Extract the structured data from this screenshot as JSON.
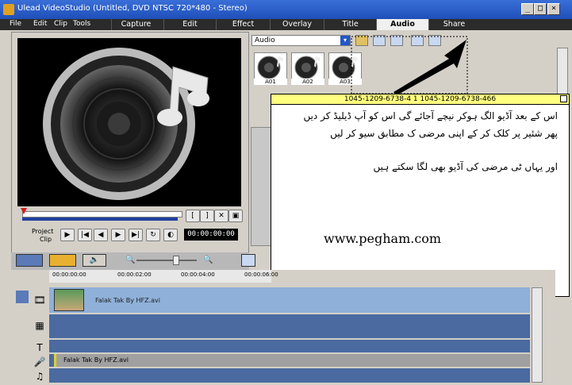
{
  "window": {
    "title": "Ulead VideoStudio (Untitled, DVD NTSC 720*480 - Stereo)"
  },
  "menu": {
    "items": [
      "File",
      "Edit",
      "Clip",
      "Tools"
    ]
  },
  "tabs": [
    {
      "label": "Capture"
    },
    {
      "label": "Edit"
    },
    {
      "label": "Effect"
    },
    {
      "label": "Overlay"
    },
    {
      "label": "Title"
    },
    {
      "label": "Audio",
      "active": true
    },
    {
      "label": "Share"
    }
  ],
  "library": {
    "category": "Audio",
    "thumbs": [
      {
        "label": "A01"
      },
      {
        "label": "A02"
      },
      {
        "label": "A03"
      }
    ]
  },
  "player": {
    "project_label": "Project",
    "clip_label": "Clip",
    "timecode": "00:00:00:00"
  },
  "timeline": {
    "ruler": [
      "00:00:00:00",
      "00:00:02:00",
      "00:00:04:00",
      "00:00:06:00"
    ],
    "video_clip": "Falak Tak By HFZ.avi",
    "audio_clip": "Falak Tak By HFZ.avi"
  },
  "note": {
    "header": "1045-1209-6738-4 1 1045-1209-6738-466",
    "line1": "اس کے بعد آڈیو الگ ہوکر نیچے آجائے گی اس کو آپ ڈیلیڈ کر دیں",
    "line2": "پھر شئیر پر کلک کر کے اپنی مرضی ک مطابق سیو کر لیں",
    "line3": "اور یہاں ٹی مرضی کی آڈیو بھی لگا سکتے ہیں",
    "url": "www.pegham.com"
  },
  "colors": {
    "titlebar": "#2456c8",
    "menubar": "#2b2b2b",
    "note_header": "#ffff80",
    "timeline_track": "#8fb0d8"
  }
}
